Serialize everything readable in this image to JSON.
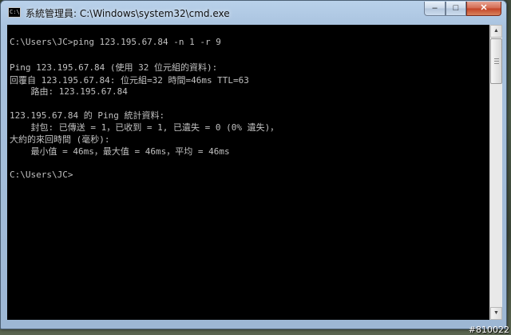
{
  "window": {
    "title": "系統管理員: C:\\Windows\\system32\\cmd.exe",
    "icon": "cmd-console-icon",
    "icon_text": "C:\\",
    "controls": {
      "minimize": "–",
      "maximize": "□",
      "close": "✕"
    }
  },
  "console": {
    "lines": [
      "C:\\Users\\JC>ping 123.195.67.84 -n 1 -r 9",
      "",
      "Ping 123.195.67.84 (使用 32 位元組的資料):",
      "回覆自 123.195.67.84: 位元組=32 時間=46ms TTL=63",
      "    路由: 123.195.67.84",
      "",
      "123.195.67.84 的 Ping 統計資料:",
      "    封包: 已傳送 = 1，已收到 = 1, 已遺失 = 0 (0% 遺失)，",
      "大約的來回時間 (毫秒):",
      "    最小值 = 46ms，最大值 = 46ms，平均 = 46ms",
      "",
      "C:\\Users\\JC>"
    ]
  },
  "watermark": "#810022"
}
